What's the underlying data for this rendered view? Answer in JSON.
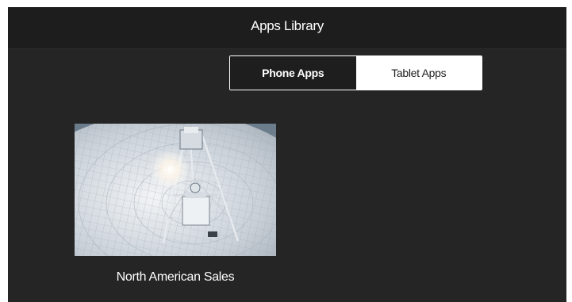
{
  "header": {
    "title": "Apps Library"
  },
  "tabs": [
    {
      "label": "Phone Apps",
      "active": true
    },
    {
      "label": "Tablet Apps",
      "active": false
    }
  ],
  "apps": [
    {
      "name": "North American Sales",
      "thumbnail": "radio-telescope-dish-image"
    }
  ],
  "colors": {
    "page_background": "#252525",
    "header_background": "#1d1d1d",
    "active_tab": "#1e1e1e",
    "inactive_tab": "#ffffff",
    "text": "#ffffff"
  }
}
